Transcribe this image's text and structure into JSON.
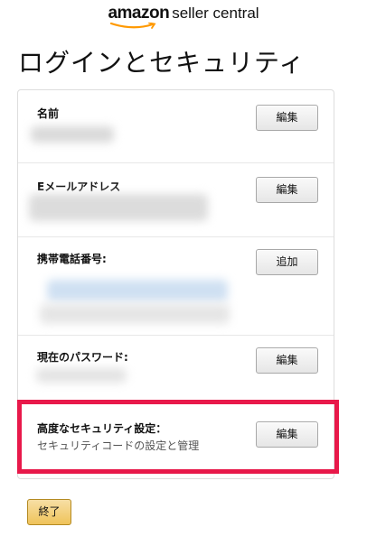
{
  "header": {
    "logo_amazon": "amazon",
    "logo_rest": "seller central"
  },
  "page": {
    "title": "ログインとセキュリティ"
  },
  "rows": [
    {
      "label": "名前",
      "button": "編集"
    },
    {
      "label": "Eメールアドレス",
      "button": "編集"
    },
    {
      "label": "携帯電話番号:",
      "button": "追加"
    },
    {
      "label": "現在のパスワード:",
      "button": "編集"
    },
    {
      "label": "高度なセキュリティ設定：",
      "sublabel": "セキュリティコードの設定と管理",
      "button": "編集"
    }
  ],
  "footer": {
    "finish_label": "終了"
  },
  "colors": {
    "highlight": "#e8194a",
    "finish_button": "#f0c14b",
    "logo_smile": "#ff9900"
  }
}
